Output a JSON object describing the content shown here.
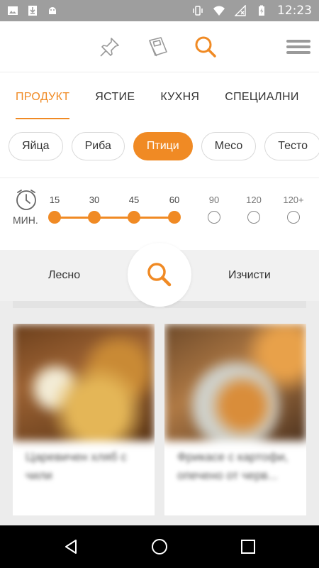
{
  "status_bar": {
    "time": "12:23",
    "left_icons": [
      "image-icon",
      "download-icon",
      "android-icon"
    ],
    "right_icons": [
      "vibrate-icon",
      "wifi-icon",
      "no-signal-icon",
      "battery-charging-icon"
    ]
  },
  "toolbar": {
    "icons": [
      "pin-icon",
      "cookbook-icon",
      "search-icon",
      "menu-icon"
    ],
    "accent": "#f08a24"
  },
  "tabs": [
    {
      "label": "ПРОДУКТ",
      "active": true
    },
    {
      "label": "ЯСТИЕ",
      "active": false
    },
    {
      "label": "КУХНЯ",
      "active": false
    },
    {
      "label": "СПЕЦИАЛНИ",
      "active": false
    }
  ],
  "chips": [
    {
      "label": "Яйца",
      "active": false
    },
    {
      "label": "Риба",
      "active": false
    },
    {
      "label": "Птици",
      "active": true
    },
    {
      "label": "Месо",
      "active": false
    },
    {
      "label": "Тесто",
      "active": false
    }
  ],
  "time_filter": {
    "unit_label": "МИН.",
    "ticks": [
      "15",
      "30",
      "45",
      "60",
      "90",
      "120",
      "120+"
    ],
    "selected_through": "60"
  },
  "search_bar": {
    "left_label": "Лесно",
    "right_label": "Изчисти"
  },
  "recipes": [
    {
      "title": "Царевичен хляб с чили"
    },
    {
      "title": "Фрикасе с картофи, опечено от черв..."
    }
  ]
}
